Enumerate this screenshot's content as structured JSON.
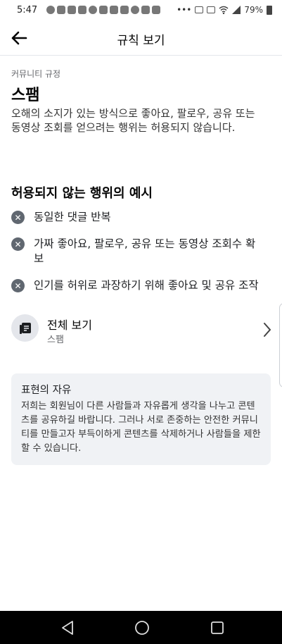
{
  "status_bar": {
    "time": "5:47",
    "battery": "79%"
  },
  "header": {
    "title": "규칙 보기"
  },
  "rule": {
    "category": "커뮤니티 규정",
    "title": "스팸",
    "description": "오해의 소지가 있는 방식으로 좋아요, 팔로우, 공유 또는 동영상 조회를 얻으려는 행위는 허용되지 않습니다."
  },
  "examples": {
    "title": "허용되지 않는 행위의 예시",
    "items": [
      "동일한 댓글 반복",
      "가짜 좋아요, 팔로우, 공유 또는 동영상 조회수 확보",
      "인기를 허위로 과장하기 위해 좋아요 및 공유 조작"
    ]
  },
  "full_view": {
    "title": "전체 보기",
    "subtitle": "스팸"
  },
  "freedom": {
    "title": "표현의 자유",
    "text": "저희는 회원님이 다른 사람들과 자유롭게 생각을 나누고 콘텐츠를 공유하길 바랍니다. 그러나 서로 존중하는 안전한 커뮤니티를 만들고자 부득이하게 콘텐츠를 삭제하거나 사람들을 제한할 수 있습니다."
  },
  "icons": {
    "back": "arrow-left-icon",
    "example": "x-circle-icon",
    "full_view": "document-icon",
    "chevron": "chevron-right-icon",
    "nav": [
      "back-triangle-icon",
      "home-circle-icon",
      "recents-square-icon"
    ]
  }
}
